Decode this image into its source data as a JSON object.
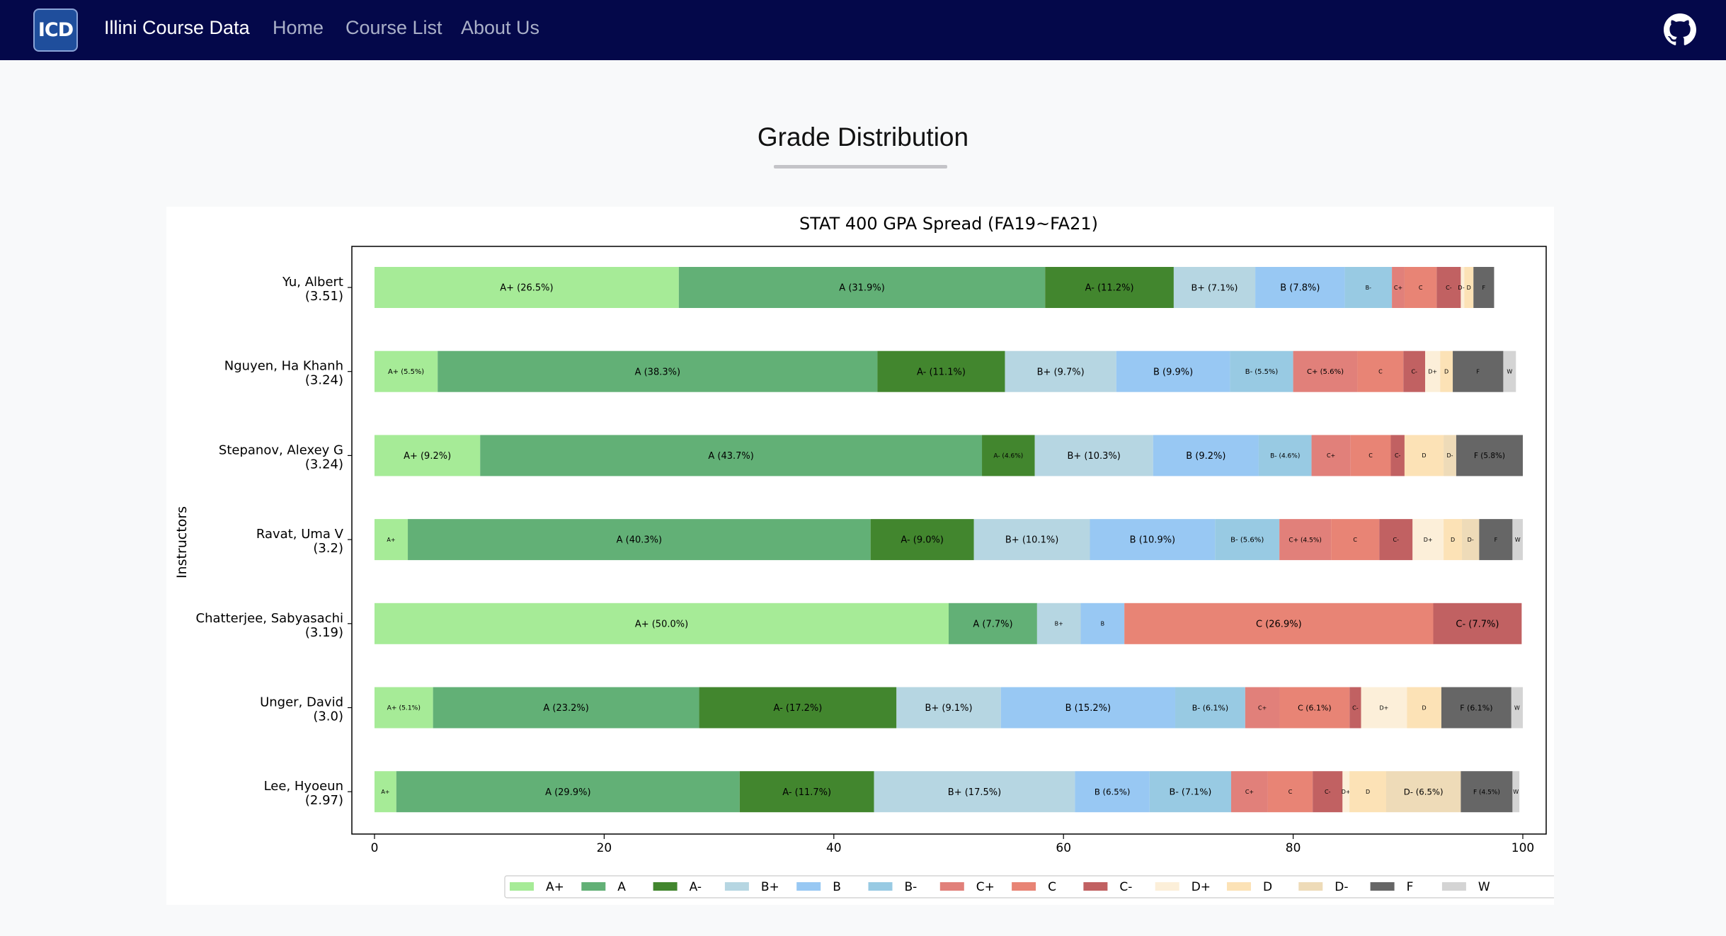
{
  "nav": {
    "logo_text": "ICD",
    "brand": "Illini Course Data",
    "links": [
      "Home",
      "Course List",
      "About Us"
    ]
  },
  "page": {
    "title": "Grade Distribution"
  },
  "colors": {
    "navbar": "#04084a",
    "grades": {
      "A+": "#a6eb97",
      "A": "#62b076",
      "A-": "#42862e",
      "B+": "#b6d6e2",
      "B": "#98c8f3",
      "B-": "#98cae3",
      "C+": "#e1807a",
      "C": "#e88475",
      "C-": "#c16162",
      "D+": "#fcefd9",
      "D": "#fce2b6",
      "D-": "#eedbb8",
      "F": "#666666",
      "W": "#d4d4d4"
    }
  },
  "chart_data": {
    "type": "bar",
    "orientation": "horizontal",
    "stacked": true,
    "title": "STAT 400 GPA Spread (FA19~FA21)",
    "ylabel": "Instructors",
    "xlabel": "",
    "xlim": [
      0,
      100
    ],
    "xticks": [
      0,
      20,
      40,
      60,
      80,
      100
    ],
    "legend_position": "bottom",
    "grades": [
      "A+",
      "A",
      "A-",
      "B+",
      "B",
      "B-",
      "C+",
      "C",
      "C-",
      "D+",
      "D",
      "D-",
      "F",
      "W"
    ],
    "instructors": [
      {
        "name": "Yu, Albert",
        "gpa": "(3.51)",
        "values": [
          26.5,
          31.9,
          11.2,
          7.1,
          7.8,
          4.1,
          1.1,
          2.8,
          2.1,
          0.3,
          0.8,
          0,
          1.8,
          0
        ]
      },
      {
        "name": "Nguyen, Ha Khanh",
        "gpa": "(3.24)",
        "values": [
          5.5,
          38.3,
          11.1,
          9.7,
          9.9,
          5.5,
          5.6,
          4.0,
          1.9,
          1.3,
          1.1,
          0,
          4.4,
          1.1
        ]
      },
      {
        "name": "Stepanov, Alexey G",
        "gpa": "(3.24)",
        "values": [
          9.2,
          43.7,
          4.6,
          10.3,
          9.2,
          4.6,
          3.4,
          3.5,
          1.2,
          0,
          3.4,
          1.1,
          5.8,
          0
        ]
      },
      {
        "name": "Ravat, Uma V",
        "gpa": "(3.2)",
        "values": [
          2.9,
          40.3,
          9.0,
          10.1,
          10.9,
          5.6,
          4.5,
          4.2,
          2.9,
          2.7,
          1.6,
          1.5,
          2.9,
          0.9
        ]
      },
      {
        "name": "Chatterjee, Sabyasachi",
        "gpa": "(3.19)",
        "values": [
          50.0,
          7.7,
          0,
          3.8,
          3.8,
          0,
          0,
          26.9,
          7.7,
          0,
          0,
          0,
          0,
          0
        ]
      },
      {
        "name": "Unger, David",
        "gpa": "(3.0)",
        "values": [
          5.1,
          23.2,
          17.2,
          9.1,
          15.2,
          6.1,
          3.0,
          6.1,
          1.0,
          4.0,
          3.0,
          0,
          6.1,
          1.0
        ]
      },
      {
        "name": "Lee, Hyoeun",
        "gpa": "(2.97)",
        "values": [
          1.9,
          29.9,
          11.7,
          17.5,
          6.5,
          7.1,
          3.2,
          3.9,
          2.6,
          0.6,
          3.2,
          6.5,
          4.5,
          0.6
        ]
      }
    ]
  }
}
